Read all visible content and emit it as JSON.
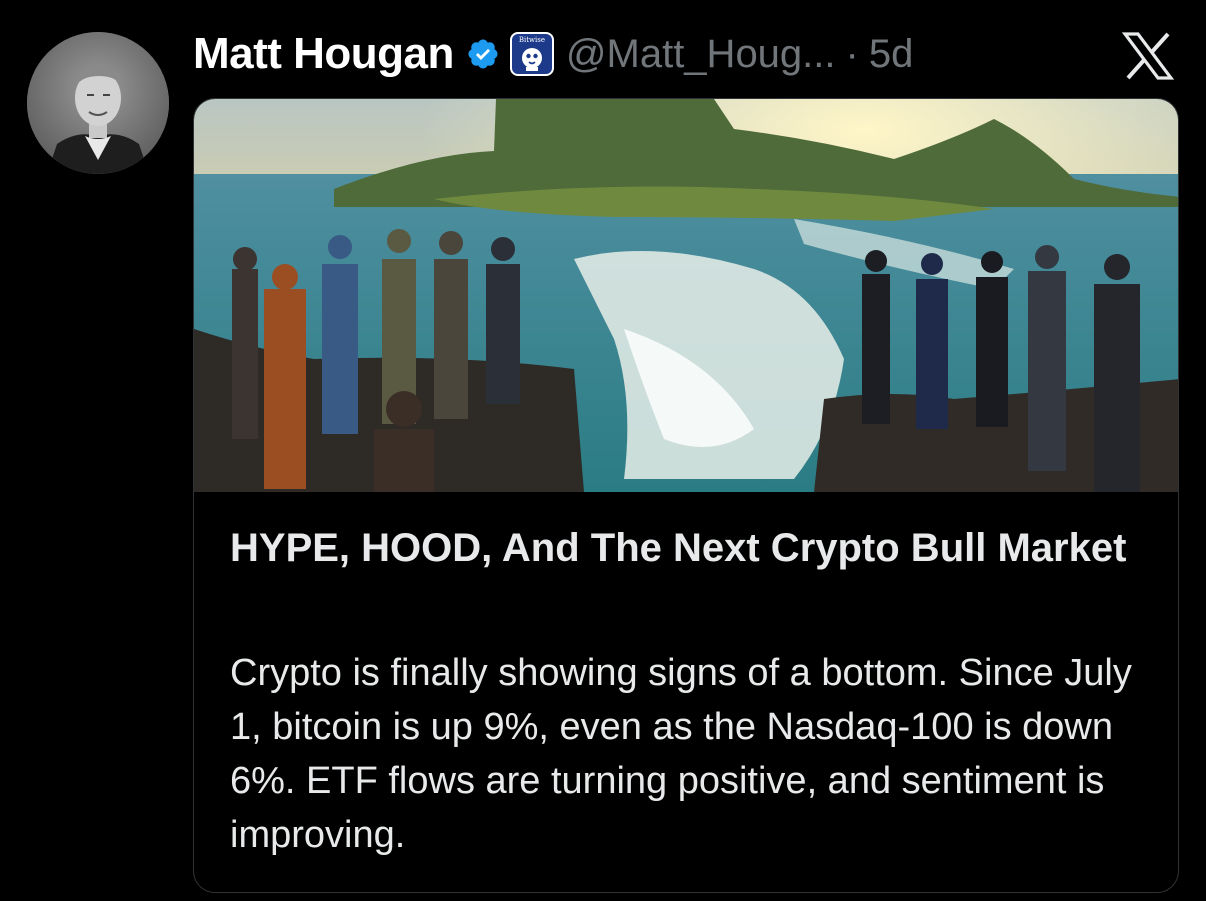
{
  "post": {
    "author_name": "Matt Hougan",
    "affiliate_badge_text": "Bitwise",
    "handle": "@Matt_Houg...",
    "separator": "·",
    "time": "5d",
    "verified_color": "#1d9bf0"
  },
  "link_card": {
    "title": "HYPE, HOOD, And The Next Crypto Bull Market",
    "description": "Crypto is finally showing signs of a bottom. Since July 1, bitcoin is up 9%, even as the Nasdaq-100 is down 6%. ETF flows are turning positive, and sentiment is improving."
  },
  "icons": {
    "verified": "verified-badge-icon",
    "affiliate": "bitwise-logo-icon",
    "brand": "x-logo-icon"
  }
}
